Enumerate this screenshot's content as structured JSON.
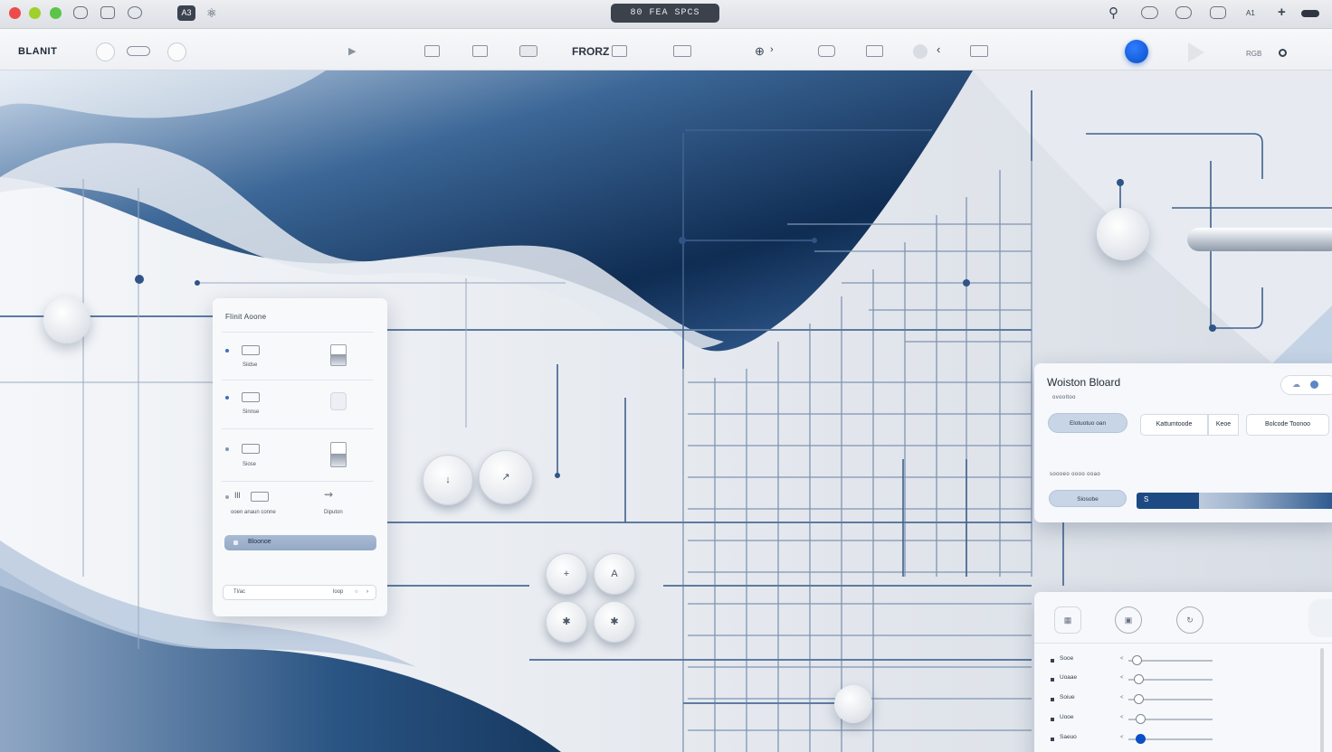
{
  "titlebar": {
    "window_title": "80 FEA SPCS",
    "active_tool_label": "A3",
    "right_label": "A1"
  },
  "toolbar": {
    "app_name": "BLANIT",
    "center_label": "FRORZ",
    "right_label": "RGB"
  },
  "left_panel": {
    "title": "Flinit Aoone",
    "rows": [
      {
        "label": "Siidse"
      },
      {
        "label": "Sinnse"
      },
      {
        "label": "Siose"
      }
    ],
    "row4": {
      "caption_left": "ooen anaun conne",
      "caption_right": "Diputon",
      "icon_text": "Ill"
    },
    "action_bar": {
      "label": "Bloonoe"
    },
    "footer": {
      "left": "Tl/ac",
      "right": "loop"
    }
  },
  "right_panel": {
    "title": "Woiston Bloard",
    "subtitle": "ovooltoo",
    "chip_left": "Elotuotuo oan",
    "segments": [
      "Kattumtoode",
      "Keoe",
      "Bolcode Toonoo"
    ],
    "section_label": "soooeo oooo ooao",
    "status_chip": "Siosobe",
    "progress": {
      "label": "S",
      "value": 0.3
    }
  },
  "slider_panel": {
    "sliders": [
      {
        "label": "Sooe",
        "value": 0.1
      },
      {
        "label": "Uoaae",
        "value": 0.12
      },
      {
        "label": "Soiue",
        "value": 0.12
      },
      {
        "label": "Uooe",
        "value": 0.14
      },
      {
        "label": "Saeuo",
        "value": 0.14
      }
    ]
  },
  "controls": {
    "pair": [
      "↓",
      "↗"
    ],
    "grid": [
      "+",
      "A",
      "✱",
      "✱"
    ]
  },
  "colors": {
    "accent": "#0a4fc7",
    "navy": "#1d4a82",
    "close": "#ed4b4b",
    "minimize": "#e9c02e",
    "zoom": "#3dc03a"
  }
}
